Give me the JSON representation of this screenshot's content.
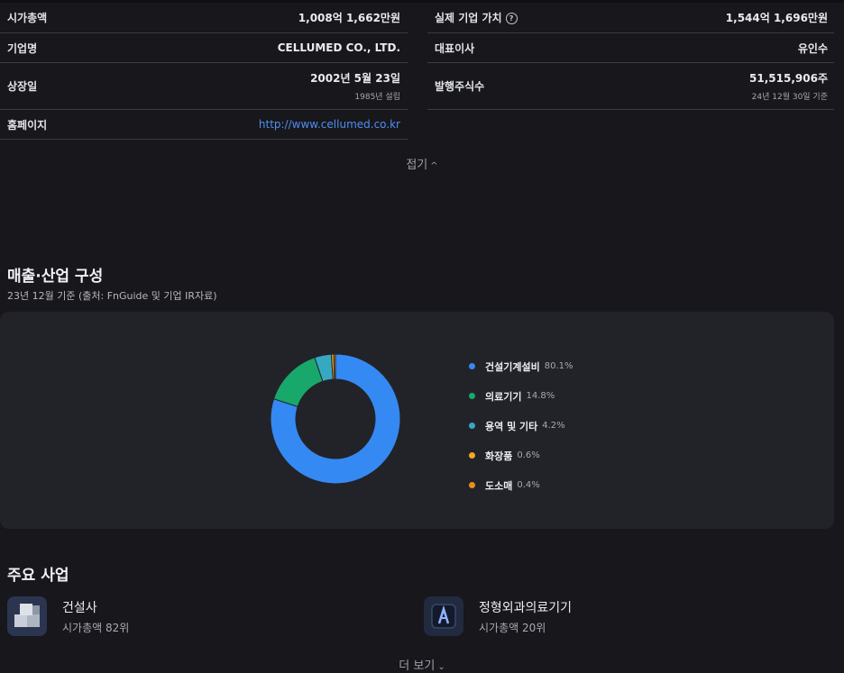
{
  "info_left": [
    {
      "label": "시가총액",
      "value": "1,008억 1,662만원"
    },
    {
      "label": "기업명",
      "value": "CELLUMED CO., LTD."
    },
    {
      "label": "상장일",
      "value": "2002년 5월 23일",
      "sub": "1985년 설립"
    },
    {
      "label": "홈페이지",
      "value": "http://www.cellumed.co.kr"
    }
  ],
  "info_right": [
    {
      "label": "실제 기업 가치",
      "help": "?",
      "value": "1,544억 1,696만원"
    },
    {
      "label": "대표이사",
      "value": "유인수"
    },
    {
      "label": "발행주식수",
      "value": "51,515,906주",
      "sub": "24년 12월 30일 기준"
    }
  ],
  "collapse": {
    "label": "접기",
    "chevron": "^"
  },
  "revenue": {
    "title": "매출·산업 구성",
    "subtitle": "23년 12월 기준 (출처: FnGuide 및 기업 IR자료)"
  },
  "chart_data": {
    "type": "pie",
    "donut": true,
    "categories": [
      "건설기계설비",
      "의료기기",
      "용역 및 기타",
      "화장품",
      "도소매"
    ],
    "values": [
      80.1,
      14.8,
      4.2,
      0.6,
      0.4
    ],
    "value_labels": [
      "80.1%",
      "14.8%",
      "4.2%",
      "0.6%",
      "0.4%"
    ],
    "colors": [
      "#3589f2",
      "#19a86b",
      "#36a8c2",
      "#f5a623",
      "#e8901a"
    ],
    "legend_position": "right"
  },
  "business": {
    "title": "주요 사업",
    "items": [
      {
        "name": "건설사",
        "rank": "시가총액 82위",
        "icon": "building-blocks-icon"
      },
      {
        "name": "정형외과의료기기",
        "rank": "시가총액 20위",
        "icon": "xray-icon"
      }
    ],
    "more_label": "더 보기"
  }
}
